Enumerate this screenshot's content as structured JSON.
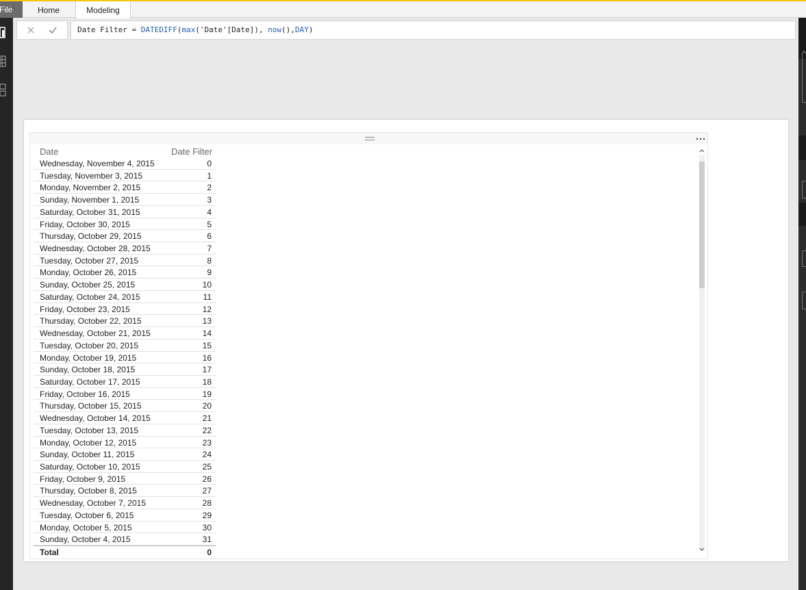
{
  "ribbon": {
    "tabs": [
      "File",
      "Home",
      "Modeling"
    ],
    "active_tab": "Modeling"
  },
  "formula_bar": {
    "cancel_icon": "close-icon",
    "commit_icon": "check-icon",
    "formula_prefix": "Date Filter = ",
    "fn_datediff": "DATEDIFF",
    "paren_open": "(",
    "fn_max": "max",
    "arg_column": "('Date'[Date]), ",
    "fn_now": "now",
    "arg_now": "(),",
    "arg_interval": "DAY",
    "paren_close": ")",
    "function_color": "#2461b5"
  },
  "left_rail": {
    "icons": [
      "report-view-icon",
      "data-view-icon",
      "relationships-view-icon"
    ]
  },
  "table_visual": {
    "columns": [
      "Date",
      "Date Filter"
    ],
    "rows": [
      {
        "date": "Wednesday, November 4, 2015",
        "value": "0"
      },
      {
        "date": "Tuesday, November 3, 2015",
        "value": "1"
      },
      {
        "date": "Monday, November 2, 2015",
        "value": "2"
      },
      {
        "date": "Sunday, November 1, 2015",
        "value": "3"
      },
      {
        "date": "Saturday, October 31, 2015",
        "value": "4"
      },
      {
        "date": "Friday, October 30, 2015",
        "value": "5"
      },
      {
        "date": "Thursday, October 29, 2015",
        "value": "6"
      },
      {
        "date": "Wednesday, October 28, 2015",
        "value": "7"
      },
      {
        "date": "Tuesday, October 27, 2015",
        "value": "8"
      },
      {
        "date": "Monday, October 26, 2015",
        "value": "9"
      },
      {
        "date": "Sunday, October 25, 2015",
        "value": "10"
      },
      {
        "date": "Saturday, October 24, 2015",
        "value": "11"
      },
      {
        "date": "Friday, October 23, 2015",
        "value": "12"
      },
      {
        "date": "Thursday, October 22, 2015",
        "value": "13"
      },
      {
        "date": "Wednesday, October 21, 2015",
        "value": "14"
      },
      {
        "date": "Tuesday, October 20, 2015",
        "value": "15"
      },
      {
        "date": "Monday, October 19, 2015",
        "value": "16"
      },
      {
        "date": "Sunday, October 18, 2015",
        "value": "17"
      },
      {
        "date": "Saturday, October 17, 2015",
        "value": "18"
      },
      {
        "date": "Friday, October 16, 2015",
        "value": "19"
      },
      {
        "date": "Thursday, October 15, 2015",
        "value": "20"
      },
      {
        "date": "Wednesday, October 14, 2015",
        "value": "21"
      },
      {
        "date": "Tuesday, October 13, 2015",
        "value": "22"
      },
      {
        "date": "Monday, October 12, 2015",
        "value": "23"
      },
      {
        "date": "Sunday, October 11, 2015",
        "value": "24"
      },
      {
        "date": "Saturday, October 10, 2015",
        "value": "25"
      },
      {
        "date": "Friday, October 9, 2015",
        "value": "26"
      },
      {
        "date": "Thursday, October 8, 2015",
        "value": "27"
      },
      {
        "date": "Wednesday, October 7, 2015",
        "value": "28"
      },
      {
        "date": "Tuesday, October 6, 2015",
        "value": "29"
      },
      {
        "date": "Monday, October 5, 2015",
        "value": "30"
      },
      {
        "date": "Sunday, October 4, 2015",
        "value": "31"
      }
    ],
    "total": {
      "label": "Total",
      "value": "0"
    },
    "more_options_icon": "ellipsis-icon",
    "drag_handle_icon": "drag-handle-icon"
  },
  "colors": {
    "accent_top": "#f2c80f",
    "rail": "#252525",
    "canvas_bg": "#e9e9e9"
  }
}
